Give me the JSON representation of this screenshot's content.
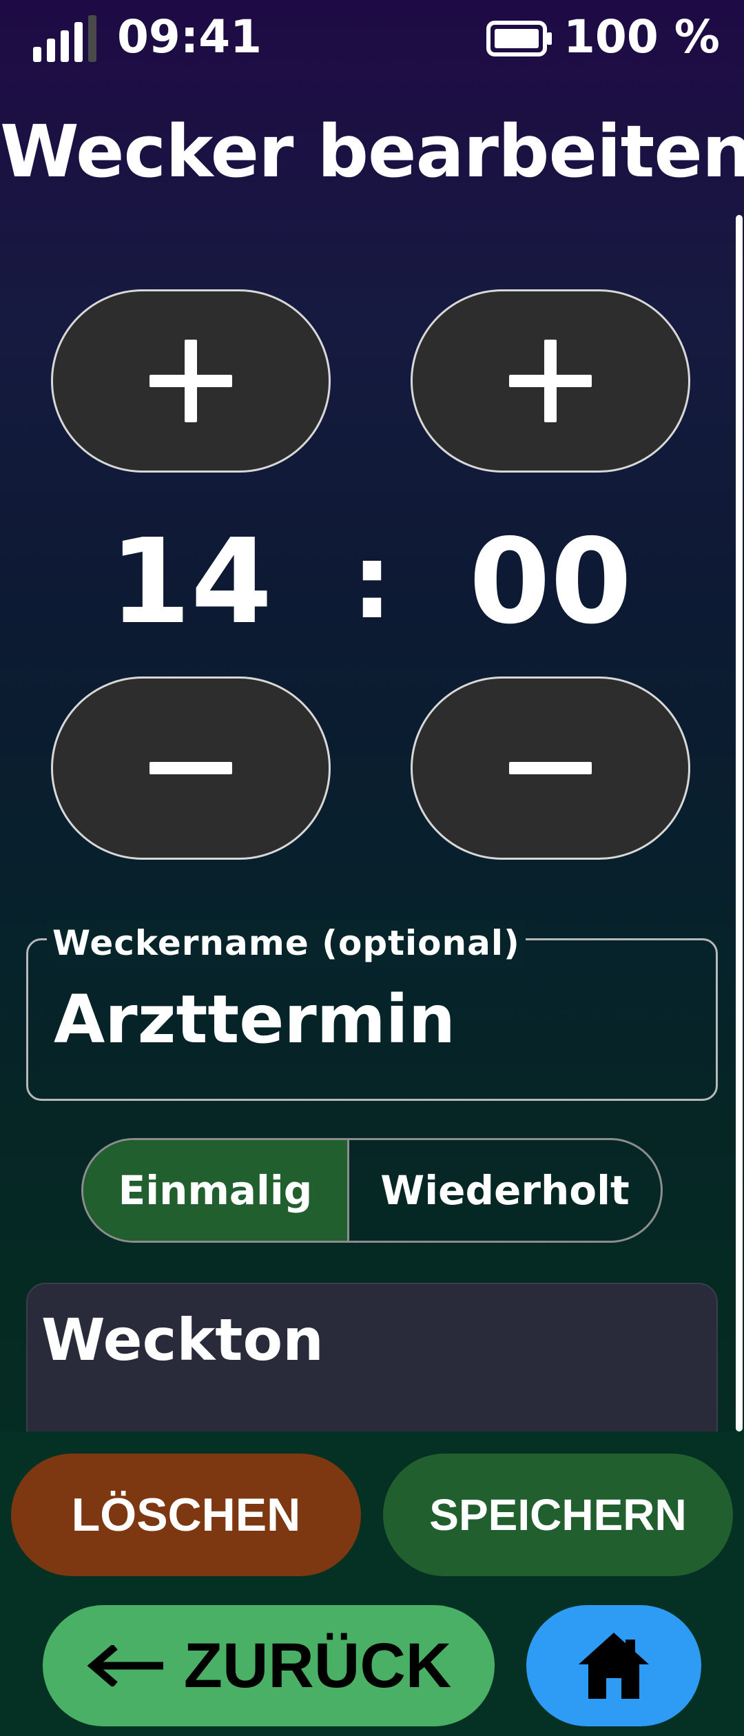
{
  "status_bar": {
    "time": "09:41",
    "battery": "100 %"
  },
  "header": {
    "title": "Wecker bearbeiten"
  },
  "time_picker": {
    "hours": "14",
    "separator": ":",
    "minutes": "00",
    "increment_icon": "plus-icon",
    "decrement_icon": "minus-icon"
  },
  "name_field": {
    "label": "Weckername (optional)",
    "value": "Arzttermin"
  },
  "repeat_mode": {
    "options": [
      "Einmalig",
      "Wiederholt"
    ],
    "selected": "Einmalig"
  },
  "sound": {
    "title": "Weckton"
  },
  "actions": {
    "delete_label": "LÖSCHEN",
    "save_label": "SPEICHERN",
    "back_label": "ZURÜCK",
    "home_icon": "home-icon"
  },
  "colors": {
    "delete": "#7e3811",
    "save": "#215f2e",
    "back": "#4ab066",
    "home": "#2e9cf5",
    "stepper": "#2d2d2d",
    "segment_selected": "#215f2e"
  }
}
